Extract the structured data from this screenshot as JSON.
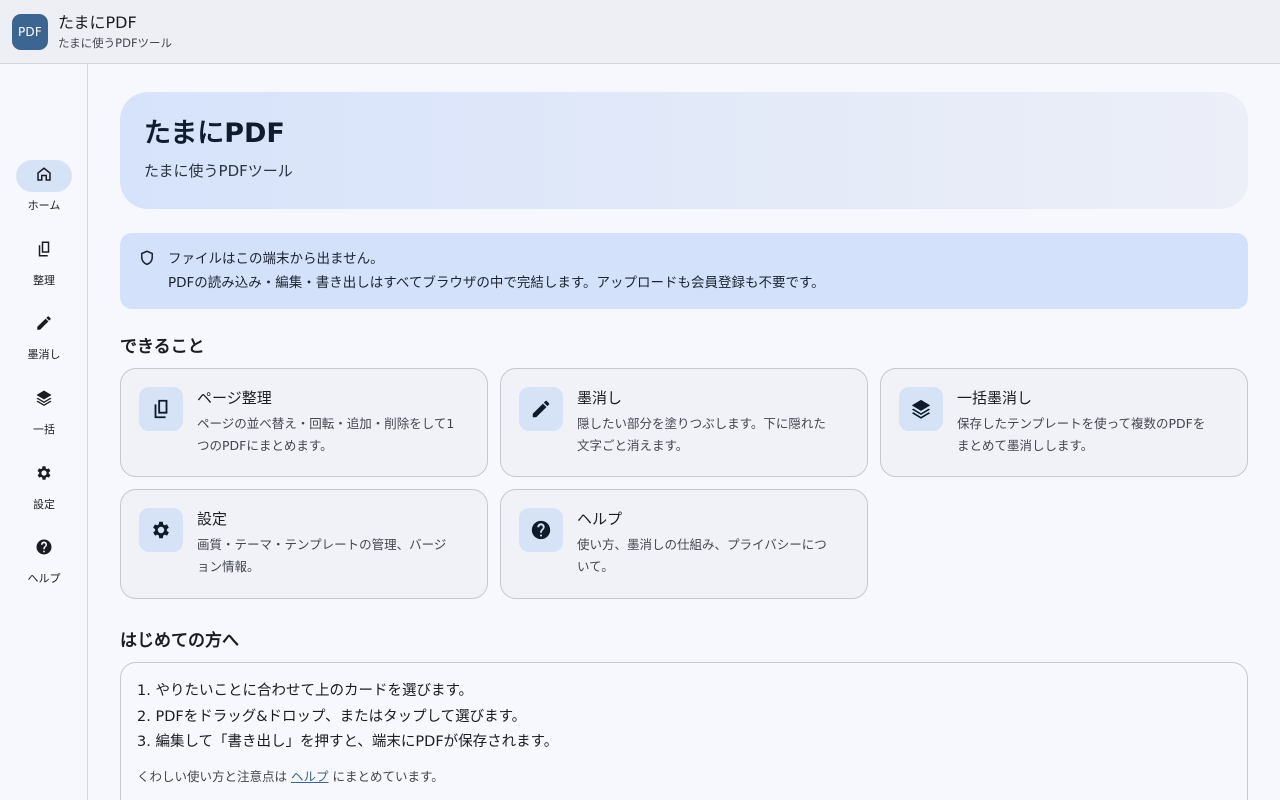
{
  "app": {
    "logo": "PDF",
    "title": "たまにPDF",
    "subtitle": "たまに使うPDFツール"
  },
  "nav": {
    "items": [
      {
        "label": "ホーム",
        "icon": "home-icon"
      },
      {
        "label": "整理",
        "icon": "pages-icon"
      },
      {
        "label": "墨消し",
        "icon": "pencil-icon"
      },
      {
        "label": "一括",
        "icon": "layers-icon"
      },
      {
        "label": "設定",
        "icon": "gear-icon"
      },
      {
        "label": "ヘルプ",
        "icon": "help-icon"
      }
    ],
    "active": "ホーム"
  },
  "hero": {
    "title": "たまにPDF",
    "subtitle": "たまに使うPDFツール"
  },
  "notice": {
    "icon": "shield-icon",
    "line1": "ファイルはこの端末から出ません。",
    "line2": "PDFの読み込み・編集・書き出しはすべてブラウザの中で完結します。アップロードも会員登録も不要です。"
  },
  "features": {
    "title": "できること",
    "cards": [
      {
        "title": "ページ整理",
        "icon": "pages-icon",
        "desc1": "ページの並べ替え・回転・追加・削除をして1",
        "desc2": "つのPDFにまとめます。"
      },
      {
        "title": "墨消し",
        "icon": "pencil-icon",
        "desc1": "隠したい部分を塗りつぶします。下に隠れた",
        "desc2": "文字ごと消えます。"
      },
      {
        "title": "一括墨消し",
        "icon": "layers-icon",
        "desc1": "保存したテンプレートを使って複数のPDFを",
        "desc2": "まとめて墨消しします。"
      },
      {
        "title": "設定",
        "icon": "gear-icon",
        "desc1": "画質・テーマ・テンプレートの管理、バージ",
        "desc2": "ョン情報。"
      },
      {
        "title": "ヘルプ",
        "icon": "help-icon",
        "desc1": "使い方、墨消しの仕組み、プライバシーにつ",
        "desc2": "いて。"
      }
    ]
  },
  "getting_started": {
    "title": "はじめての方へ",
    "steps": [
      "1. やりたいことに合わせて上のカードを選びます。",
      "2. PDFをドラッグ&ドロップ、またはタップして選びます。",
      "3. 編集して「書き出し」を押すと、端末にPDFが保存されます。"
    ],
    "note_before": "くわしい使い方と注意点は",
    "note_link": "ヘルプ",
    "note_after": "にまとめています。"
  },
  "colors": {
    "accent": "#3d6592",
    "hero_bg": "#d6e3fb",
    "notice_bg": "#d3e2fa",
    "icon_bg": "#d6e3f7"
  }
}
